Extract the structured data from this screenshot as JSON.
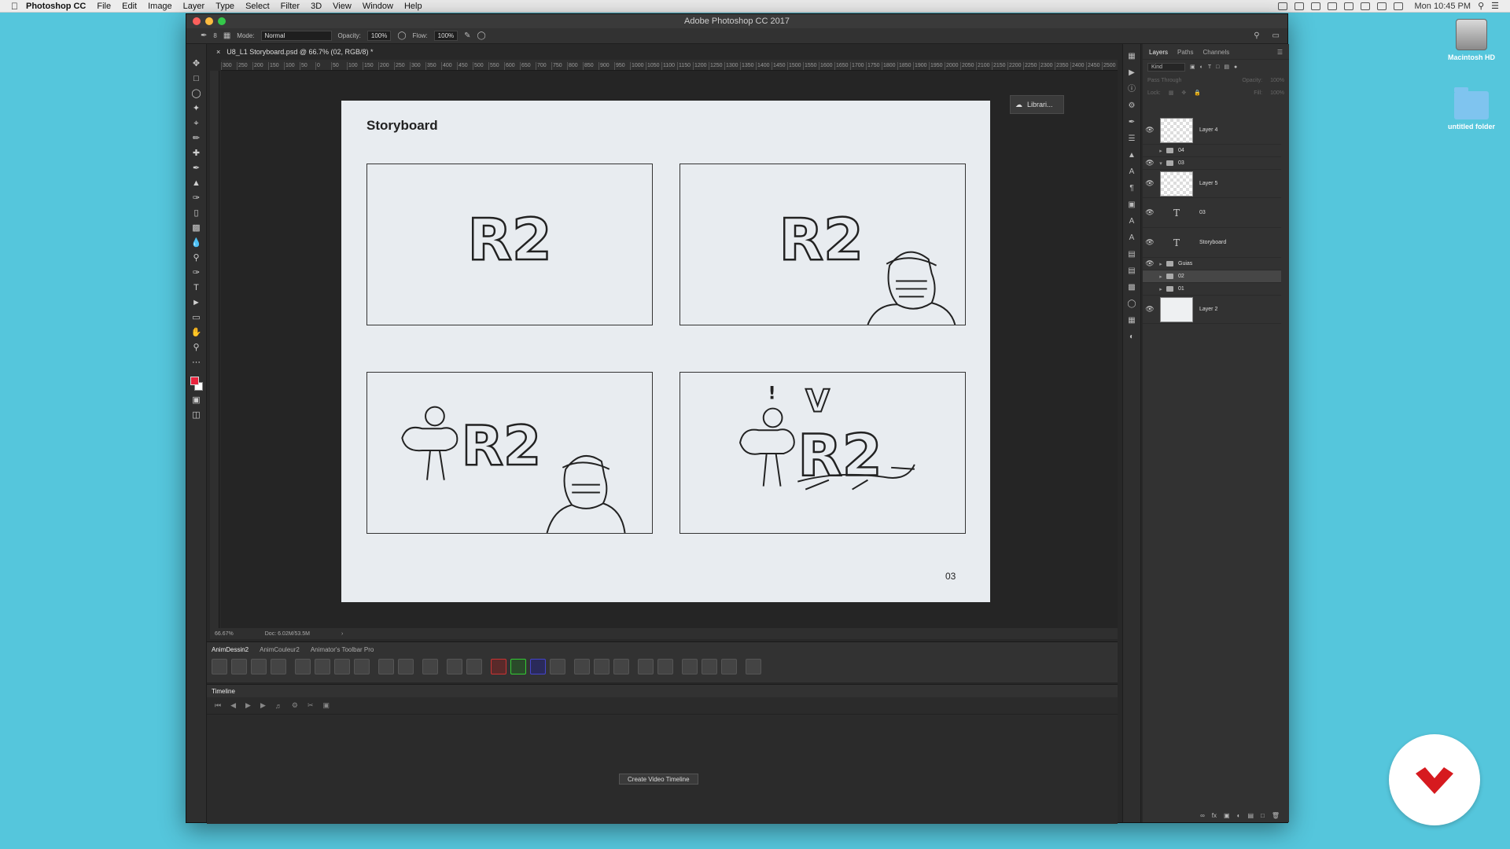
{
  "menubar": {
    "app": "Photoshop CC",
    "items": [
      "File",
      "Edit",
      "Image",
      "Layer",
      "Type",
      "Select",
      "Filter",
      "3D",
      "View",
      "Window",
      "Help"
    ],
    "clock": "Mon 10:45 PM"
  },
  "desktop": {
    "drive_label": "Macintosh HD",
    "folder_label": "untitled folder"
  },
  "window": {
    "title": "Adobe Photoshop CC 2017",
    "doc_tab": "U8_L1 Storyboard.psd @ 66.7% (02, RGB/8) *"
  },
  "options": {
    "brush_size": "8",
    "mode_label": "Mode:",
    "mode_value": "Normal",
    "opacity_label": "Opacity:",
    "opacity_value": "100%",
    "flow_label": "Flow:",
    "flow_value": "100%"
  },
  "ruler": {
    "ticks": [
      "300",
      "250",
      "200",
      "150",
      "100",
      "50",
      "0",
      "50",
      "100",
      "150",
      "200",
      "250",
      "300",
      "350",
      "400",
      "450",
      "500",
      "550",
      "600",
      "650",
      "700",
      "750",
      "800",
      "850",
      "900",
      "950",
      "1000",
      "1050",
      "1100",
      "1150",
      "1200",
      "1250",
      "1300",
      "1350",
      "1400",
      "1450",
      "1500",
      "1550",
      "1600",
      "1650",
      "1700",
      "1750",
      "1800",
      "1850",
      "1900",
      "1950",
      "2000",
      "2050",
      "2100",
      "2150",
      "2200",
      "2250",
      "2300",
      "2350",
      "2400",
      "2450",
      "2500"
    ]
  },
  "document": {
    "title": "Storyboard",
    "page_number": "03",
    "frame_texts": [
      "R2",
      "R2",
      "R2",
      "R2"
    ],
    "frame_marks": {
      "exclamation": "!",
      "v": "V"
    }
  },
  "libraries_button": "Librari...",
  "status": {
    "zoom": "66.67%",
    "doc_size": "Doc: 6.02M/53.5M"
  },
  "extension_panel": {
    "tabs": [
      "AnimDessin2",
      "AnimCouleur2",
      "Animator's Toolbar Pro"
    ]
  },
  "timeline": {
    "title": "Timeline",
    "create_button": "Create Video Timeline"
  },
  "layers_panel": {
    "tabs": [
      "Layers",
      "Paths",
      "Channels"
    ],
    "kind_label": "Kind",
    "blend_mode": "Pass Through",
    "opacity_label": "Opacity:",
    "opacity_value": "100%",
    "lock_label": "Lock:",
    "fill_label": "Fill:",
    "fill_value": "100%",
    "layers": [
      {
        "name": "Layer 4",
        "kind": "pixel"
      },
      {
        "name": "04",
        "kind": "group"
      },
      {
        "name": "03",
        "kind": "group-open"
      },
      {
        "name": "Layer 5",
        "kind": "pixel"
      },
      {
        "name": "03",
        "kind": "text"
      },
      {
        "name": "Storyboard",
        "kind": "text"
      },
      {
        "name": "Guias",
        "kind": "group"
      },
      {
        "name": "02",
        "kind": "group"
      },
      {
        "name": "01",
        "kind": "group"
      },
      {
        "name": "Layer 2",
        "kind": "pixel-white"
      }
    ]
  },
  "colors": {
    "desktop": "#55c6dc",
    "foreground": "#e8233d",
    "logo_red": "#d61a1f"
  }
}
